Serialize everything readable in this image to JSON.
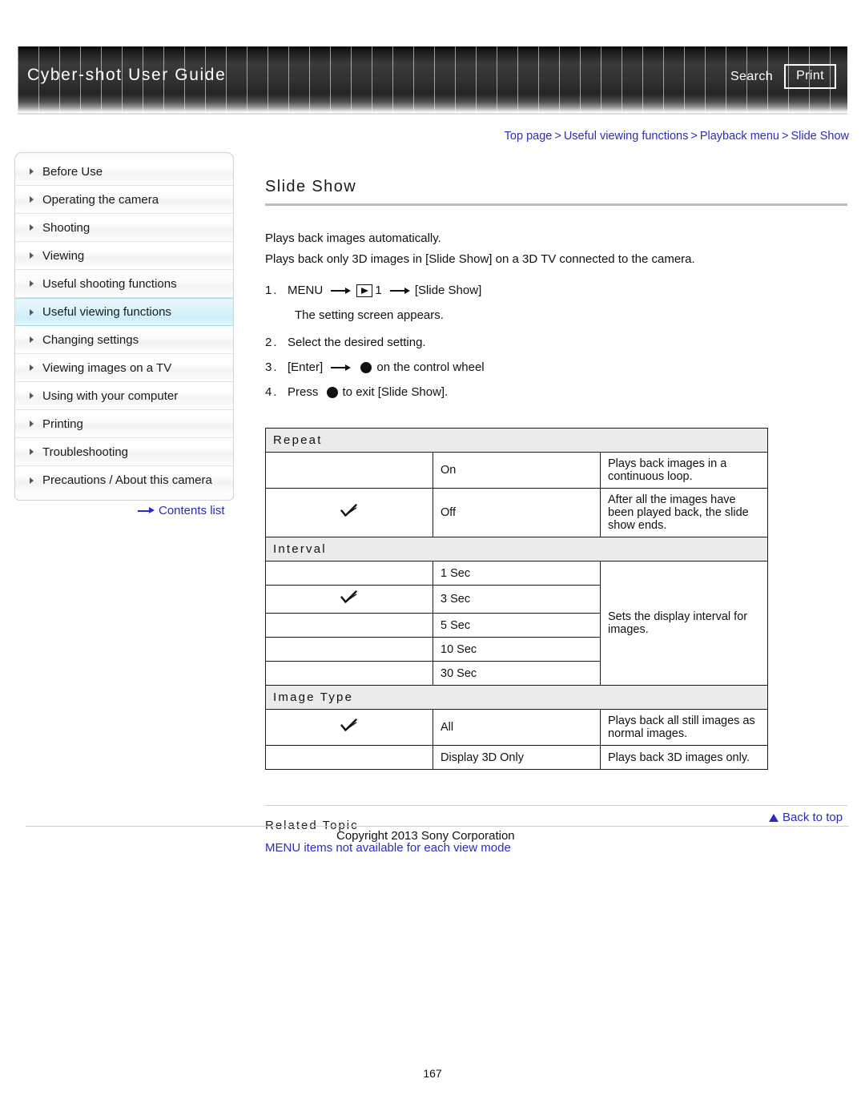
{
  "header": {
    "title": "Cyber-shot User Guide",
    "search_label": "Search",
    "print_label": "Print"
  },
  "breadcrumb": {
    "items": [
      "Top page",
      "Useful viewing functions",
      "Playback menu",
      "Slide Show"
    ],
    "separator": ">"
  },
  "sidebar": {
    "items": [
      {
        "label": "Before Use",
        "active": false
      },
      {
        "label": "Operating the camera",
        "active": false
      },
      {
        "label": "Shooting",
        "active": false
      },
      {
        "label": "Viewing",
        "active": false
      },
      {
        "label": "Useful shooting functions",
        "active": false
      },
      {
        "label": "Useful viewing functions",
        "active": true
      },
      {
        "label": "Changing settings",
        "active": false
      },
      {
        "label": "Viewing images on a TV",
        "active": false
      },
      {
        "label": "Using with your computer",
        "active": false
      },
      {
        "label": "Printing",
        "active": false
      },
      {
        "label": "Troubleshooting",
        "active": false
      },
      {
        "label": "Precautions / About this camera",
        "active": false
      }
    ],
    "contents_list_label": "Contents list"
  },
  "main": {
    "title": "Slide Show",
    "intro": [
      "Plays back images automatically.",
      "Plays back only 3D images in [Slide Show] on a 3D TV connected to the camera."
    ],
    "steps": [
      {
        "num": "1.",
        "parts": [
          "MENU",
          "arrow",
          "playback-icon",
          "1",
          "arrow",
          "[Slide Show]"
        ],
        "sub": "The setting screen appears."
      },
      {
        "num": "2.",
        "parts": [
          "Select the desired setting."
        ],
        "sub": ""
      },
      {
        "num": "3.",
        "parts": [
          "[Enter]",
          "arrow",
          "wheel-dot",
          "on the control wheel"
        ],
        "sub": ""
      },
      {
        "num": "4.",
        "parts": [
          "Press",
          "wheel-dot",
          "to exit [Slide Show]."
        ],
        "sub": ""
      }
    ],
    "table": {
      "groups": [
        {
          "name": "Repeat",
          "rows": [
            {
              "checked": false,
              "option": "On",
              "description": "Plays back images in a continuous loop."
            },
            {
              "checked": true,
              "option": "Off",
              "description": "After all the images have been played back, the slide show ends."
            }
          ]
        },
        {
          "name": "Interval",
          "shared_description": "Sets the display interval for images.",
          "rows": [
            {
              "checked": false,
              "option": "1 Sec"
            },
            {
              "checked": true,
              "option": "3 Sec"
            },
            {
              "checked": false,
              "option": "5 Sec"
            },
            {
              "checked": false,
              "option": "10 Sec"
            },
            {
              "checked": false,
              "option": "30 Sec"
            }
          ]
        },
        {
          "name": "Image Type",
          "rows": [
            {
              "checked": true,
              "option": "All",
              "description": "Plays back all still images as normal images."
            },
            {
              "checked": false,
              "option": "Display 3D Only",
              "description": "Plays back 3D images only."
            }
          ]
        }
      ]
    },
    "related": {
      "heading": "Related Topic",
      "link": "MENU items not available for each view mode"
    }
  },
  "footer": {
    "back_to_top": "Back to top",
    "copyright": "Copyright 2013 Sony Corporation",
    "page_number": "167"
  },
  "colors": {
    "link": "#2b2bc0",
    "active_nav_bg": "#dcf3fb",
    "group_header_bg": "#ebebeb",
    "banner_dark": "#1b1b1b"
  }
}
